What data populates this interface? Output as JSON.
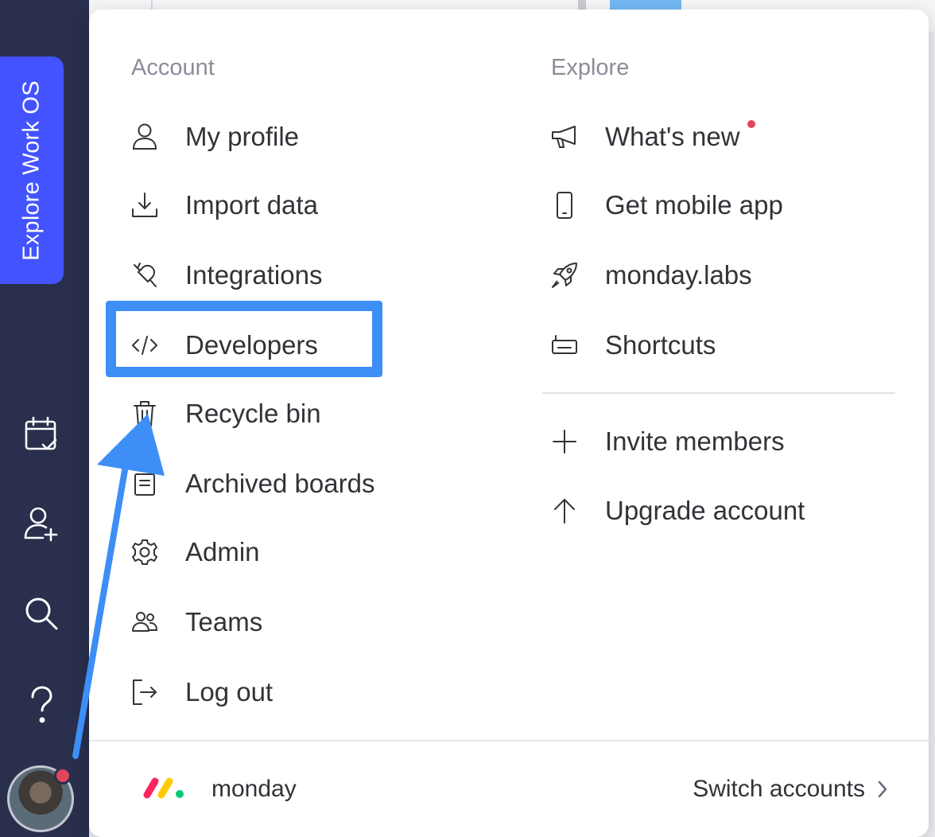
{
  "sidebar": {
    "explore_tab": "Explore Work OS",
    "icons": [
      "calendar-check-icon",
      "add-user-icon",
      "search-icon",
      "help-icon"
    ],
    "avatar": "user-avatar",
    "notification_color": "#e2445c"
  },
  "menu": {
    "account": {
      "title": "Account",
      "items": [
        {
          "label": "My profile",
          "icon": "user-icon"
        },
        {
          "label": "Import data",
          "icon": "download-icon"
        },
        {
          "label": "Integrations",
          "icon": "plug-icon"
        },
        {
          "label": "Developers",
          "icon": "code-icon"
        },
        {
          "label": "Recycle bin",
          "icon": "trash-icon"
        },
        {
          "label": "Archived boards",
          "icon": "archive-icon"
        },
        {
          "label": "Admin",
          "icon": "gear-icon"
        },
        {
          "label": "Teams",
          "icon": "teams-icon"
        },
        {
          "label": "Log out",
          "icon": "logout-icon"
        }
      ]
    },
    "explore": {
      "title": "Explore",
      "items": [
        {
          "label": "What's new",
          "icon": "megaphone-icon",
          "badge": true
        },
        {
          "label": "Get mobile app",
          "icon": "mobile-icon"
        },
        {
          "label": "monday.labs",
          "icon": "rocket-icon"
        },
        {
          "label": "Shortcuts",
          "icon": "keyboard-icon"
        }
      ],
      "actions": [
        {
          "label": "Invite members",
          "icon": "plus-icon"
        },
        {
          "label": "Upgrade account",
          "icon": "arrow-up-icon"
        }
      ]
    }
  },
  "footer": {
    "account_name": "monday",
    "switch_label": "Switch accounts"
  },
  "colors": {
    "sidebar_bg": "#292f4c",
    "explore_tab": "#4353ff",
    "annotation": "#3d8ef7",
    "badge": "#e2445c"
  }
}
